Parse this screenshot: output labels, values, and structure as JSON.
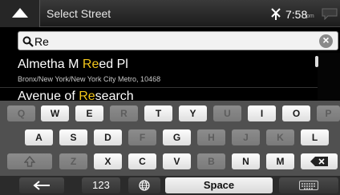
{
  "header": {
    "title": "Select Street",
    "time": "7:58",
    "time_suffix": "pm"
  },
  "search": {
    "value": "Re"
  },
  "results": [
    {
      "name_before": "Almetha M ",
      "name_match": "Re",
      "name_after": "ed Pl",
      "subtitle": "Bronx/New York/New York City Metro, 10468"
    },
    {
      "name_before": "Avenue of ",
      "name_match": "Re",
      "name_after": "search",
      "subtitle": ""
    }
  ],
  "keyboard": {
    "row1": [
      "Q",
      "W",
      "E",
      "R",
      "T",
      "Y",
      "U",
      "I",
      "O",
      "P"
    ],
    "row2": [
      "A",
      "S",
      "D",
      "F",
      "G",
      "H",
      "J",
      "K",
      "L"
    ],
    "row3": [
      "Z",
      "X",
      "C",
      "V",
      "B",
      "N",
      "M"
    ],
    "numbers_label": "123",
    "space_label": "Space"
  },
  "colors": {
    "highlight": "#f3c61b",
    "key_bg": "#f2f2f2",
    "key_dim_bg": "#848484"
  }
}
